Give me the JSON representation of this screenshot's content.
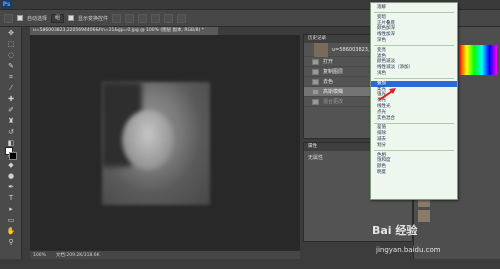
{
  "app": {
    "logo": "Ps"
  },
  "menubar": {
    "items": [
      "",
      "",
      "",
      "",
      "",
      "",
      "",
      "",
      "",
      ""
    ]
  },
  "optionsbar": {
    "auto_select_label": "自动选择",
    "auto_select_value": "组",
    "show_transform_label": "显示变换控件"
  },
  "document": {
    "tab_title": "u=586003823,2205694406&fm=21&gp=0.jpg @ 100% (图层 副本, RGB/8) *"
  },
  "status": {
    "zoom": "100%",
    "doc_size": "文档:209.2K/318.6K"
  },
  "history_panel": {
    "tab_label": "历史记录",
    "snapshot_label": "u=586003823,2205694406...",
    "items": [
      {
        "label": "打开",
        "state": "normal"
      },
      {
        "label": "复制图层",
        "state": "normal"
      },
      {
        "label": "去色",
        "state": "normal"
      },
      {
        "label": "高斯模糊",
        "state": "selected"
      },
      {
        "label": "混合更改",
        "state": "dim"
      }
    ]
  },
  "properties_panel": {
    "tab_label": "属性",
    "content": "无属性"
  },
  "blend_menu": {
    "groups": [
      [
        "溶解"
      ],
      [
        "变暗",
        "正片叠底",
        "颜色加深",
        "线性加深",
        "深色"
      ],
      [
        "变亮",
        "滤色",
        "颜色减淡",
        "线性减淡（添加）",
        "浅色"
      ],
      [
        "叠加",
        "柔光",
        "强光",
        "亮光",
        "线性光",
        "点光",
        "实色混合"
      ],
      [
        "差值",
        "排除",
        "减去",
        "划分"
      ],
      [
        "色相",
        "饱和度",
        "颜色",
        "明度"
      ]
    ],
    "selected": "叠加"
  },
  "watermark": {
    "logo_text": "Bai 经验",
    "url": "jingyan.baidu.com"
  }
}
